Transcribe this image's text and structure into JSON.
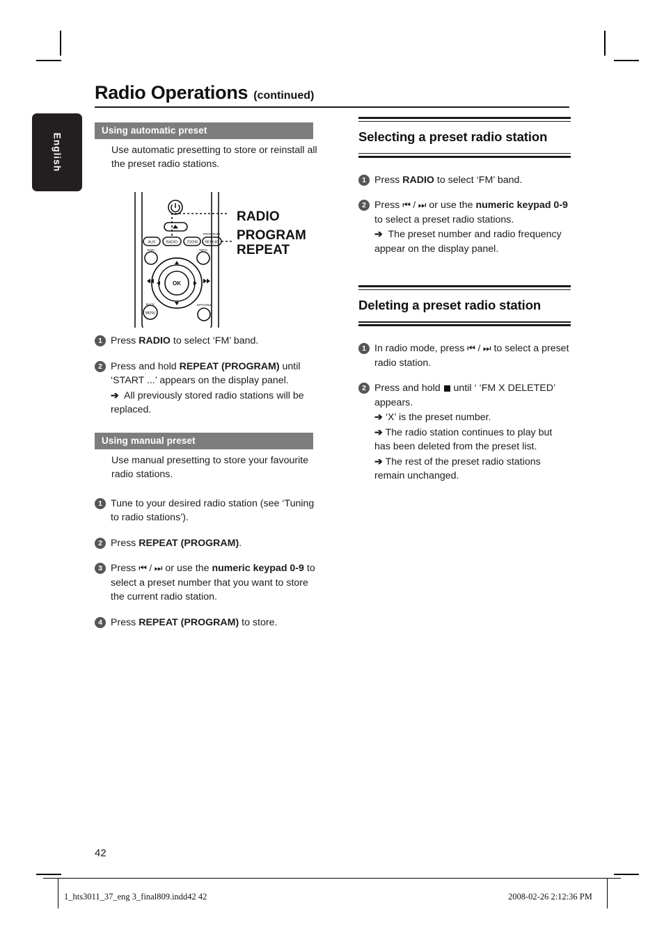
{
  "document": {
    "title": "Radio Operations",
    "title_suffix": "(continued)",
    "language_tab": "English",
    "page_number": "42"
  },
  "left_column": {
    "section_auto": {
      "bar_label": "Using automatic preset",
      "intro": "Use automatic presetting to store or reinstall all the preset radio stations.",
      "steps": [
        {
          "number": "1",
          "text_parts": [
            {
              "t": "Press ",
              "b": false
            },
            {
              "t": "RADIO",
              "b": true
            },
            {
              "t": " to select ‘FM’ band.",
              "b": false
            }
          ]
        },
        {
          "number": "2",
          "text_parts": [
            {
              "t": "Press and hold ",
              "b": false
            },
            {
              "t": "REPEAT (PROGRAM)",
              "b": true
            },
            {
              "t": " until ‘START ...’ appears on the display panel.",
              "b": false
            }
          ],
          "results": [
            "All previously stored radio stations will be replaced."
          ]
        }
      ]
    },
    "section_manual": {
      "bar_label": "Using manual preset",
      "intro": "Use manual presetting to store your favourite radio stations.",
      "steps": [
        {
          "number": "1",
          "text_parts": [
            {
              "t": "Tune to your desired radio station (see ‘Tuning to radio stations’).",
              "b": false
            }
          ]
        },
        {
          "number": "2",
          "text_parts": [
            {
              "t": "Press ",
              "b": false
            },
            {
              "t": "REPEAT (PROGRAM)",
              "b": true
            },
            {
              "t": ".",
              "b": false
            }
          ]
        },
        {
          "number": "3",
          "text_parts": [
            {
              "t": "Press ",
              "b": false
            },
            {
              "t": "⧏◀ / ▶⧐",
              "b": false,
              "glyph": true
            },
            {
              "t": " or use the ",
              "b": false
            },
            {
              "t": "numeric keypad 0-9",
              "b": true
            },
            {
              "t": " to select a preset number that you want to store the current radio station.",
              "b": false
            }
          ]
        },
        {
          "number": "4",
          "text_parts": [
            {
              "t": "Press ",
              "b": false
            },
            {
              "t": "REPEAT (PROGRAM)",
              "b": true
            },
            {
              "t": " to store.",
              "b": false
            }
          ]
        }
      ]
    }
  },
  "right_column": {
    "section_select": {
      "heading": "Selecting a preset radio station",
      "steps": [
        {
          "number": "1",
          "text_parts": [
            {
              "t": "Press ",
              "b": false
            },
            {
              "t": "RADIO",
              "b": true
            },
            {
              "t": " to select ‘FM’ band.",
              "b": false
            }
          ]
        },
        {
          "number": "2",
          "text_parts": [
            {
              "t": "Press ",
              "b": false
            },
            {
              "t": "⧏◀ / ▶⧐",
              "b": false,
              "glyph": true
            },
            {
              "t": " or use the ",
              "b": false
            },
            {
              "t": "numeric keypad 0-9",
              "b": true
            },
            {
              "t": " to select a preset radio stations.",
              "b": false
            }
          ],
          "results": [
            "The preset number and radio frequency appear on the display panel."
          ]
        }
      ]
    },
    "section_delete": {
      "heading": "Deleting a preset radio station",
      "steps": [
        {
          "number": "1",
          "text_parts": [
            {
              "t": "In radio mode, press ",
              "b": false
            },
            {
              "t": "⧏◀ / ▶⧐",
              "b": false,
              "glyph": true
            },
            {
              "t": " to select a preset radio station.",
              "b": false
            }
          ]
        },
        {
          "number": "2",
          "text_parts": [
            {
              "t": "Press and hold ",
              "b": false
            },
            {
              "t": "■",
              "b": false,
              "stop": true
            },
            {
              "t": " until ‘ ‘FM X DELETED’ appears.",
              "b": false
            }
          ],
          "results": [
            "‘X’ is the preset number.",
            "The radio station continues to play but has been deleted from the preset list.",
            "The rest of the preset radio stations remain unchanged."
          ]
        }
      ]
    }
  },
  "illustration": {
    "name": "remote-control-diagram",
    "callouts": [
      {
        "label": "RADIO"
      },
      {
        "label": "PROGRAM",
        "label2": "REPEAT"
      }
    ],
    "remote_buttons": {
      "power": "⏻",
      "eject": "▲",
      "row": [
        "AUX",
        "RADIO",
        "ZOOM",
        "REPEAT"
      ],
      "row_top_label": "PROGRAM",
      "disc": "DISC",
      "info": "INFO",
      "center": "OK",
      "back": "BACK",
      "menu": "MENU",
      "options": "OPTIONS",
      "prev": "◀◀",
      "next": "▶▶"
    }
  },
  "footer": {
    "file_name": "1_hts3011_37_eng 3_final809.indd42   42",
    "timestamp": "2008-02-26   2:12:36 PM"
  },
  "colors": {
    "gray_bar": "#7d7d7d",
    "step_circle": "#54565a",
    "tab_bg": "#231f20",
    "ink": "#1a1a1a"
  }
}
